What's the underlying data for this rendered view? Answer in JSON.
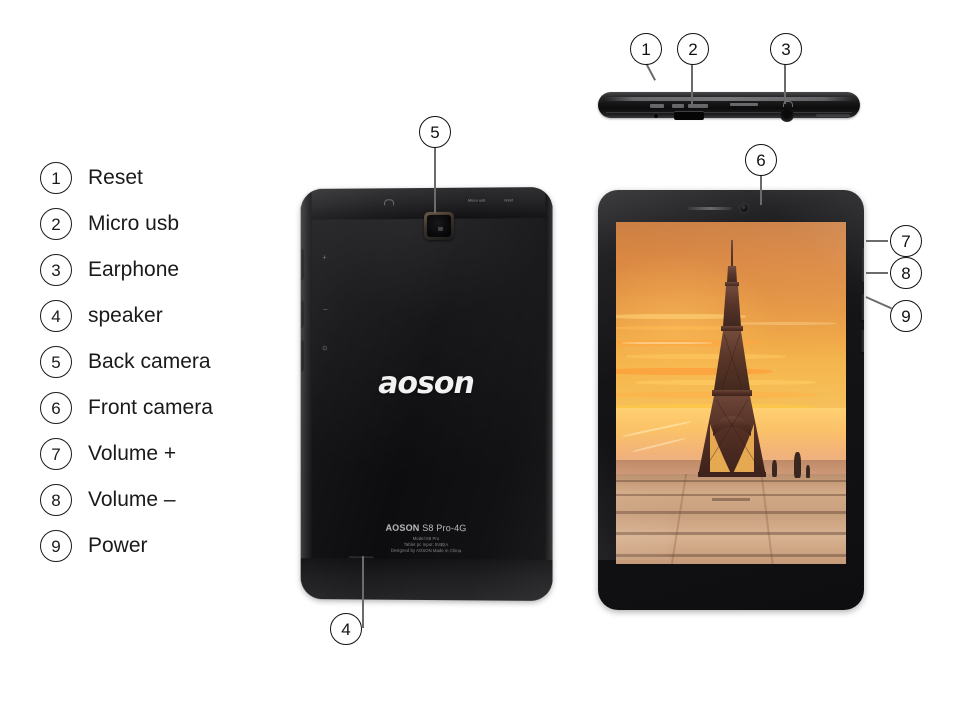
{
  "legend": {
    "items": [
      {
        "num": "1",
        "label": "Reset"
      },
      {
        "num": "2",
        "label": "Micro usb"
      },
      {
        "num": "3",
        "label": "Earphone"
      },
      {
        "num": "4",
        "label": "speaker"
      },
      {
        "num": "5",
        "label": "Back camera"
      },
      {
        "num": "6",
        "label": "Front camera"
      },
      {
        "num": "7",
        "label": "Volume +"
      },
      {
        "num": "8",
        "label": "Volume –"
      },
      {
        "num": "9",
        "label": "Power"
      }
    ]
  },
  "callouts": {
    "top_edge": [
      {
        "num": "1",
        "target": "reset-pinhole"
      },
      {
        "num": "2",
        "target": "micro-usb-port"
      },
      {
        "num": "3",
        "target": "earphone-jack"
      }
    ],
    "back": [
      {
        "num": "5",
        "target": "back-camera"
      },
      {
        "num": "4",
        "target": "speaker-grille"
      }
    ],
    "front": [
      {
        "num": "6",
        "target": "front-camera"
      },
      {
        "num": "7",
        "target": "volume-up-button"
      },
      {
        "num": "8",
        "target": "volume-down-button"
      },
      {
        "num": "9",
        "target": "power-button"
      }
    ]
  },
  "device": {
    "brand_logo": "aoson",
    "back_labels": {
      "micro_usb": "Micro usb",
      "reset": "reset"
    },
    "back_print": {
      "product": "AOSON ",
      "model_name": "S8 Pro-4G",
      "line1": "Model:S8 Pro",
      "line2": "Tablet pc    Input: 5V⌸2A",
      "line3": "Designed by AOSON Made in China"
    },
    "side_marks": {
      "volume_up": "+",
      "volume_down": "–",
      "power": "⏻"
    }
  },
  "colors": {
    "badge_border": "#111111",
    "legend_text": "#1a1a1a",
    "leader_line": "#6b6b6b",
    "device_black": "#141416",
    "sky_top": "#c9793a",
    "sky_bright": "#f7c25c",
    "cloud_yellow": "#ffc947",
    "cloud_orange": "#ff9a33",
    "haze": "#ffd071",
    "plaza_tan": "#d3aa87",
    "tower_dark": "#4a2e22"
  },
  "wallpaper": {
    "name": "eiffel-tower-sunset",
    "subject": "Eiffel Tower",
    "scene": "Paris plaza at sunset with silhouetted figures"
  }
}
